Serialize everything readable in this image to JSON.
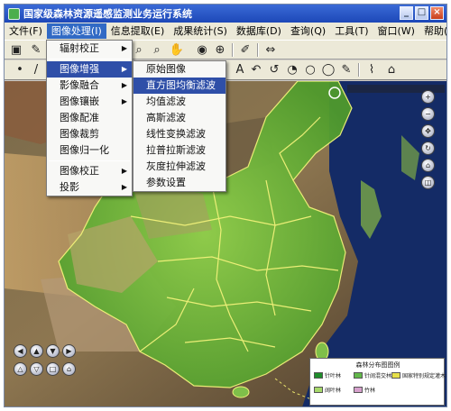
{
  "window": {
    "title": "国家级森林资源遥感监测业务运行系统"
  },
  "menubar": [
    "文件(F)",
    "图像处理(I)",
    "信息提取(E)",
    "成果统计(S)",
    "数据库(D)",
    "查询(Q)",
    "工具(T)",
    "窗口(W)",
    "帮助(H)"
  ],
  "menu_image": {
    "items": [
      "辐射校正",
      "图像增强",
      "影像融合",
      "图像镶嵌",
      "图像配准",
      "图像裁剪",
      "图像归一化",
      "图像校正",
      "投影"
    ],
    "highlighted": "图像增强"
  },
  "submenu_enhance": {
    "items": [
      "原始图像",
      "直方图均衡滤波",
      "均值滤波",
      "高斯滤波",
      "线性变换滤波",
      "拉普拉斯滤波",
      "灰度拉伸滤波",
      "参数设置"
    ],
    "highlighted": "直方图均衡滤波"
  },
  "legend": {
    "title": "森林分布图图例",
    "items": [
      "针叶林",
      "针阔混交林",
      "阔叶林",
      "竹林",
      "国家特别规定灌木林"
    ],
    "colors": [
      "#1e8c2a",
      "#62b84a",
      "#a6d86a",
      "#d6a0cc",
      "#e6e04a"
    ]
  },
  "colors": {
    "titlebar": "#1d48b8",
    "menu_highlight": "#2f4fa8",
    "forest": "#5bbf3a",
    "border_lines": "#f2f27a"
  }
}
